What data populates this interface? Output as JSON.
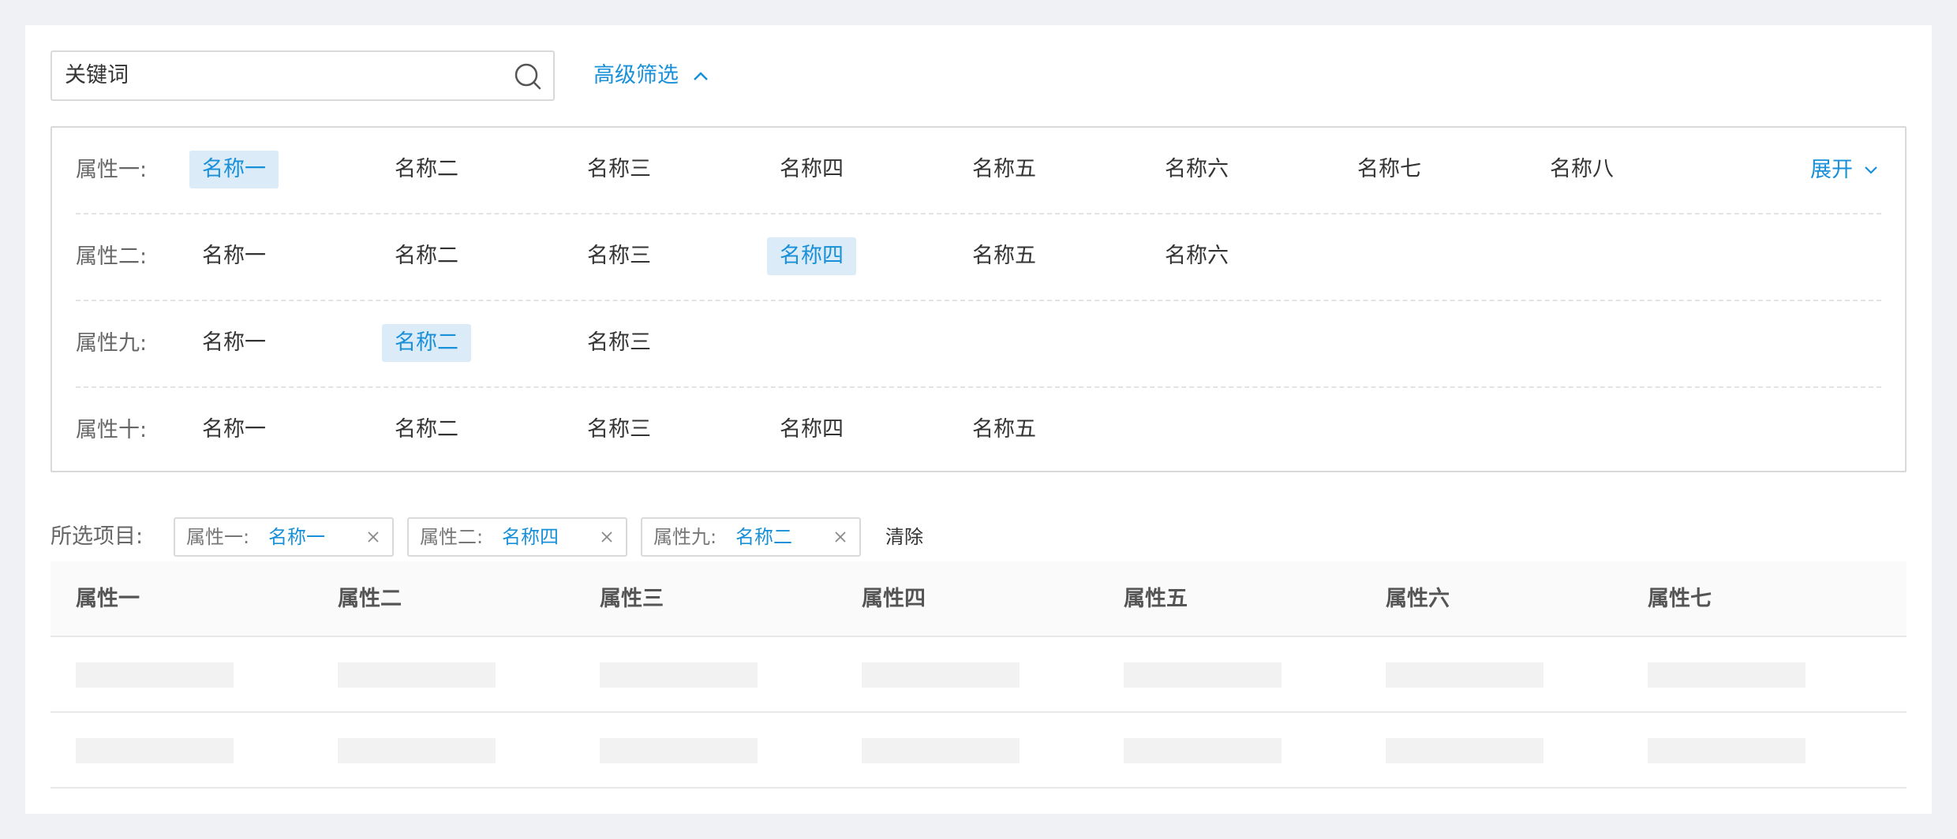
{
  "search": {
    "value": "关键词",
    "icon": "search-icon"
  },
  "advanced_filter": {
    "label": "高级筛选",
    "icon": "chevron-up-icon"
  },
  "expand": {
    "label": "展开",
    "icon": "chevron-down-icon"
  },
  "filter_rows": [
    {
      "label": "属性一:",
      "options": [
        "名称一",
        "名称二",
        "名称三",
        "名称四",
        "名称五",
        "名称六",
        "名称七",
        "名称八"
      ],
      "selected": 0
    },
    {
      "label": "属性二:",
      "options": [
        "名称一",
        "名称二",
        "名称三",
        "名称四",
        "名称五",
        "名称六"
      ],
      "selected": 3
    },
    {
      "label": "属性九:",
      "options": [
        "名称一",
        "名称二",
        "名称三"
      ],
      "selected": 1
    },
    {
      "label": "属性十:",
      "options": [
        "名称一",
        "名称二",
        "名称三",
        "名称四",
        "名称五"
      ],
      "selected": -1
    }
  ],
  "selected_items": {
    "label": "所选项目:",
    "tags": [
      {
        "attr": "属性一:",
        "value": "名称一"
      },
      {
        "attr": "属性二:",
        "value": "名称四"
      },
      {
        "attr": "属性九:",
        "value": "名称二"
      }
    ],
    "clear_label": "清除"
  },
  "table": {
    "columns": [
      "属性一",
      "属性二",
      "属性三",
      "属性四",
      "属性五",
      "属性六",
      "属性七"
    ]
  },
  "colors": {
    "accent": "#1890d8",
    "selected_bg": "#dcebf8",
    "page_bg": "#eff1f5"
  }
}
